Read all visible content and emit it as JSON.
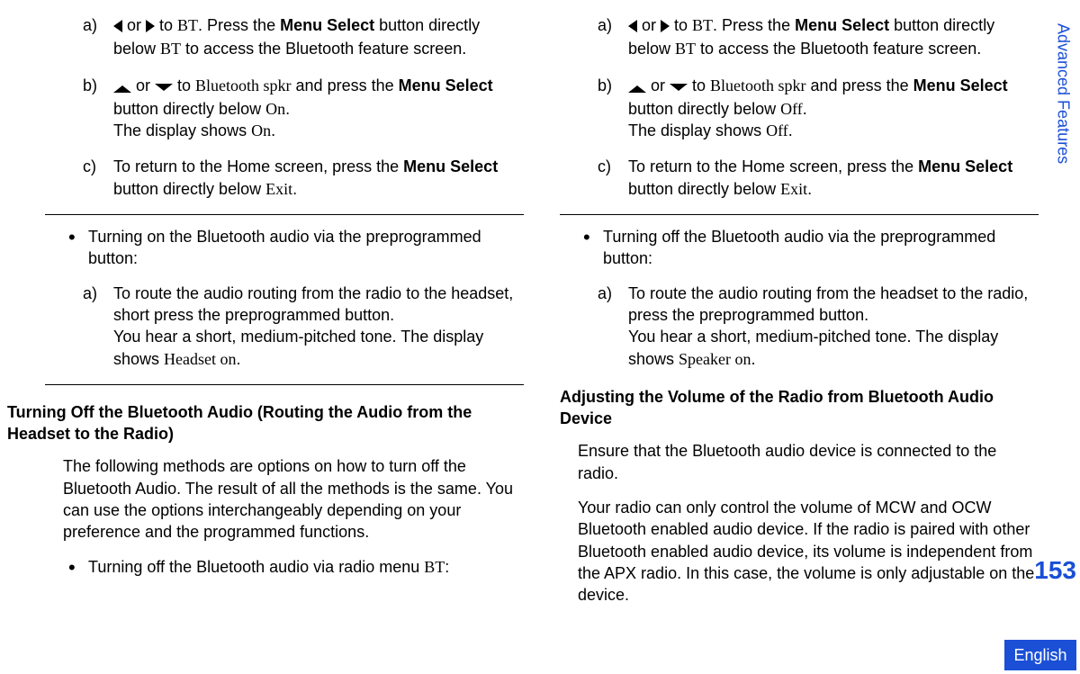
{
  "sidebar": {
    "label": "Advanced Features"
  },
  "pagination": {
    "number": "153"
  },
  "footer": {
    "language": "English"
  },
  "ui": {
    "BT": "BT",
    "bluetooth_spkr": "Bluetooth spkr",
    "On": "On",
    "Off": "Off",
    "Exit": "Exit",
    "Headset_on": "Headset on",
    "Speaker_on": "Speaker on",
    "Menu_Select": "Menu Select"
  },
  "left": {
    "list1": {
      "a": {
        "marker": "a)",
        "pre": " or ",
        "mid": " to ",
        "after_bt": ". Press the ",
        "bold1": "Menu Select",
        "after_bold": " button directly below ",
        "after_bt2": " to access the Bluetooth feature screen."
      },
      "b": {
        "marker": "b)",
        "pre": " or ",
        "mid": " to ",
        "after_spkr": " and press the ",
        "bold1": "Menu Select",
        "after_bold": " button directly below ",
        "period": ".",
        "line2a": "The display shows ",
        "line2b": "."
      },
      "c": {
        "marker": "c)",
        "text1": "To return to the Home screen, press the ",
        "bold1": "Menu Select",
        "text2": " button directly below ",
        "period": "."
      }
    },
    "bullet1": "Turning on the Bluetooth audio via the preprogrammed button:",
    "sub_a": {
      "marker": "a)",
      "line1": "To route the audio routing from the radio to the headset, short press the preprogrammed button.",
      "line2a": "You hear a short, medium-pitched tone. The display shows ",
      "line2b": "."
    },
    "heading": "Turning Off the Bluetooth Audio (Routing the Audio from the Headset to the Radio)",
    "para1": "The following methods are options on how to turn off the Bluetooth Audio. The result of all the methods is the same. You can use the options interchangeably depending on your preference and the programmed functions.",
    "bullet2a": "Turning off the Bluetooth audio via radio menu ",
    "bullet2b": ":"
  },
  "right": {
    "list1": {
      "a": {
        "marker": "a)",
        "pre": " or ",
        "mid": " to ",
        "after_bt": ". Press the ",
        "bold1": "Menu Select",
        "after_bold": " button directly below ",
        "after_bt2": " to access the Bluetooth feature screen."
      },
      "b": {
        "marker": "b)",
        "pre": " or ",
        "mid": " to ",
        "after_spkr": " and press the ",
        "bold1": "Menu Select",
        "after_bold": " button directly below ",
        "period": ".",
        "line2a": "The display shows ",
        "line2b": "."
      },
      "c": {
        "marker": "c)",
        "text1": "To return to the Home screen, press the ",
        "bold1": "Menu Select",
        "text2": " button directly below ",
        "period": "."
      }
    },
    "bullet1": "Turning off the Bluetooth audio via the preprogrammed button:",
    "sub_a": {
      "marker": "a)",
      "line1": "To route the audio routing from the headset to the radio, press the preprogrammed button.",
      "line2a": "You hear a short, medium-pitched tone. The display shows ",
      "line2b": "."
    },
    "heading": "Adjusting the Volume of the Radio from Bluetooth Audio Device",
    "para1": "Ensure that the Bluetooth audio device is connected to the radio.",
    "para2": "Your radio can only control the volume of MCW and OCW Bluetooth enabled audio device. If the radio is paired with other Bluetooth enabled audio device, its volume is independent from the APX radio. In this case, the volume is only adjustable on the device."
  }
}
